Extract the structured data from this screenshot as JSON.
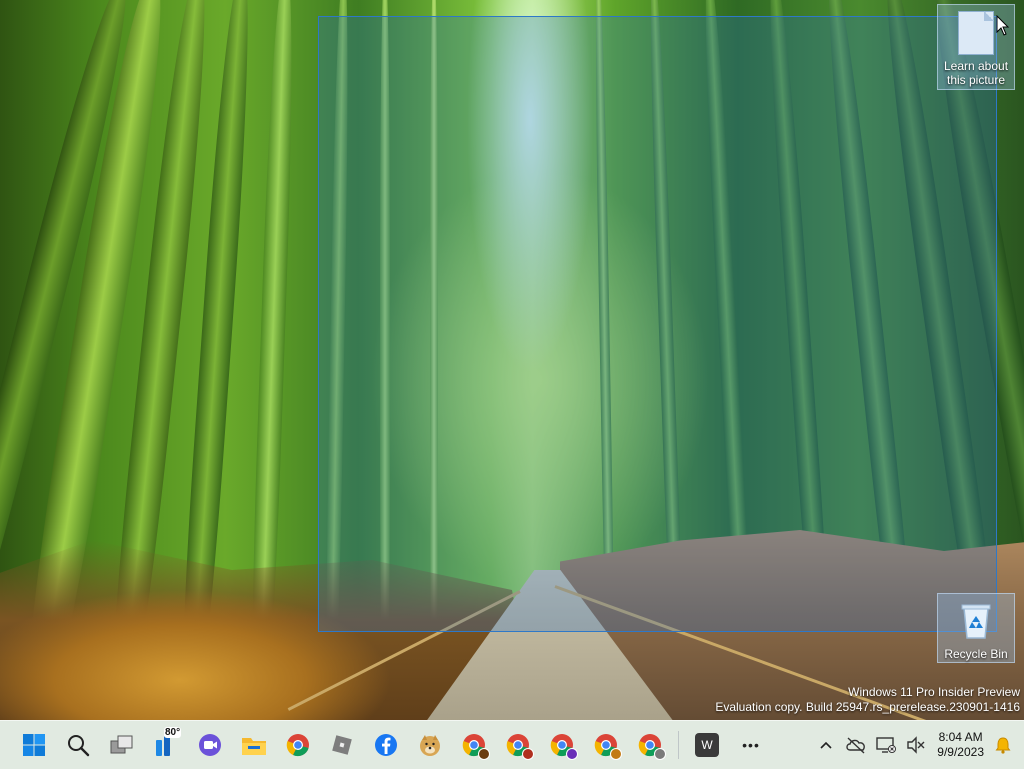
{
  "desktop": {
    "icons": [
      {
        "label_line1": "Learn about",
        "label_line2": "this picture"
      },
      {
        "label": "Recycle Bin"
      }
    ],
    "watermark": {
      "line1": "Windows 11 Pro Insider Preview",
      "line2": "Evaluation copy. Build 25947.rs_prerelease.230901-1416"
    }
  },
  "taskbar": {
    "weather_temp": "80°",
    "pinned": [
      "start-icon",
      "search-icon",
      "task-view-icon",
      "weather-widget-icon",
      "meet-icon",
      "file-explorer-icon",
      "chrome-icon",
      "roblox-icon",
      "facebook-icon",
      "doge-icon",
      "chrome-profile-1-icon",
      "chrome-profile-2-icon",
      "chrome-profile-3-icon",
      "chrome-profile-4-icon",
      "chrome-profile-5-icon",
      "word-app-icon",
      "more-apps-icon"
    ],
    "word_letter": "W",
    "more_label": "•••"
  },
  "tray": {
    "time": "8:04 AM",
    "date": "9/9/2023"
  },
  "colors": {
    "selection_border": "#2e78c8",
    "taskbar_bg": "#eef4f0",
    "windows_blue": "#0f7bd8"
  }
}
